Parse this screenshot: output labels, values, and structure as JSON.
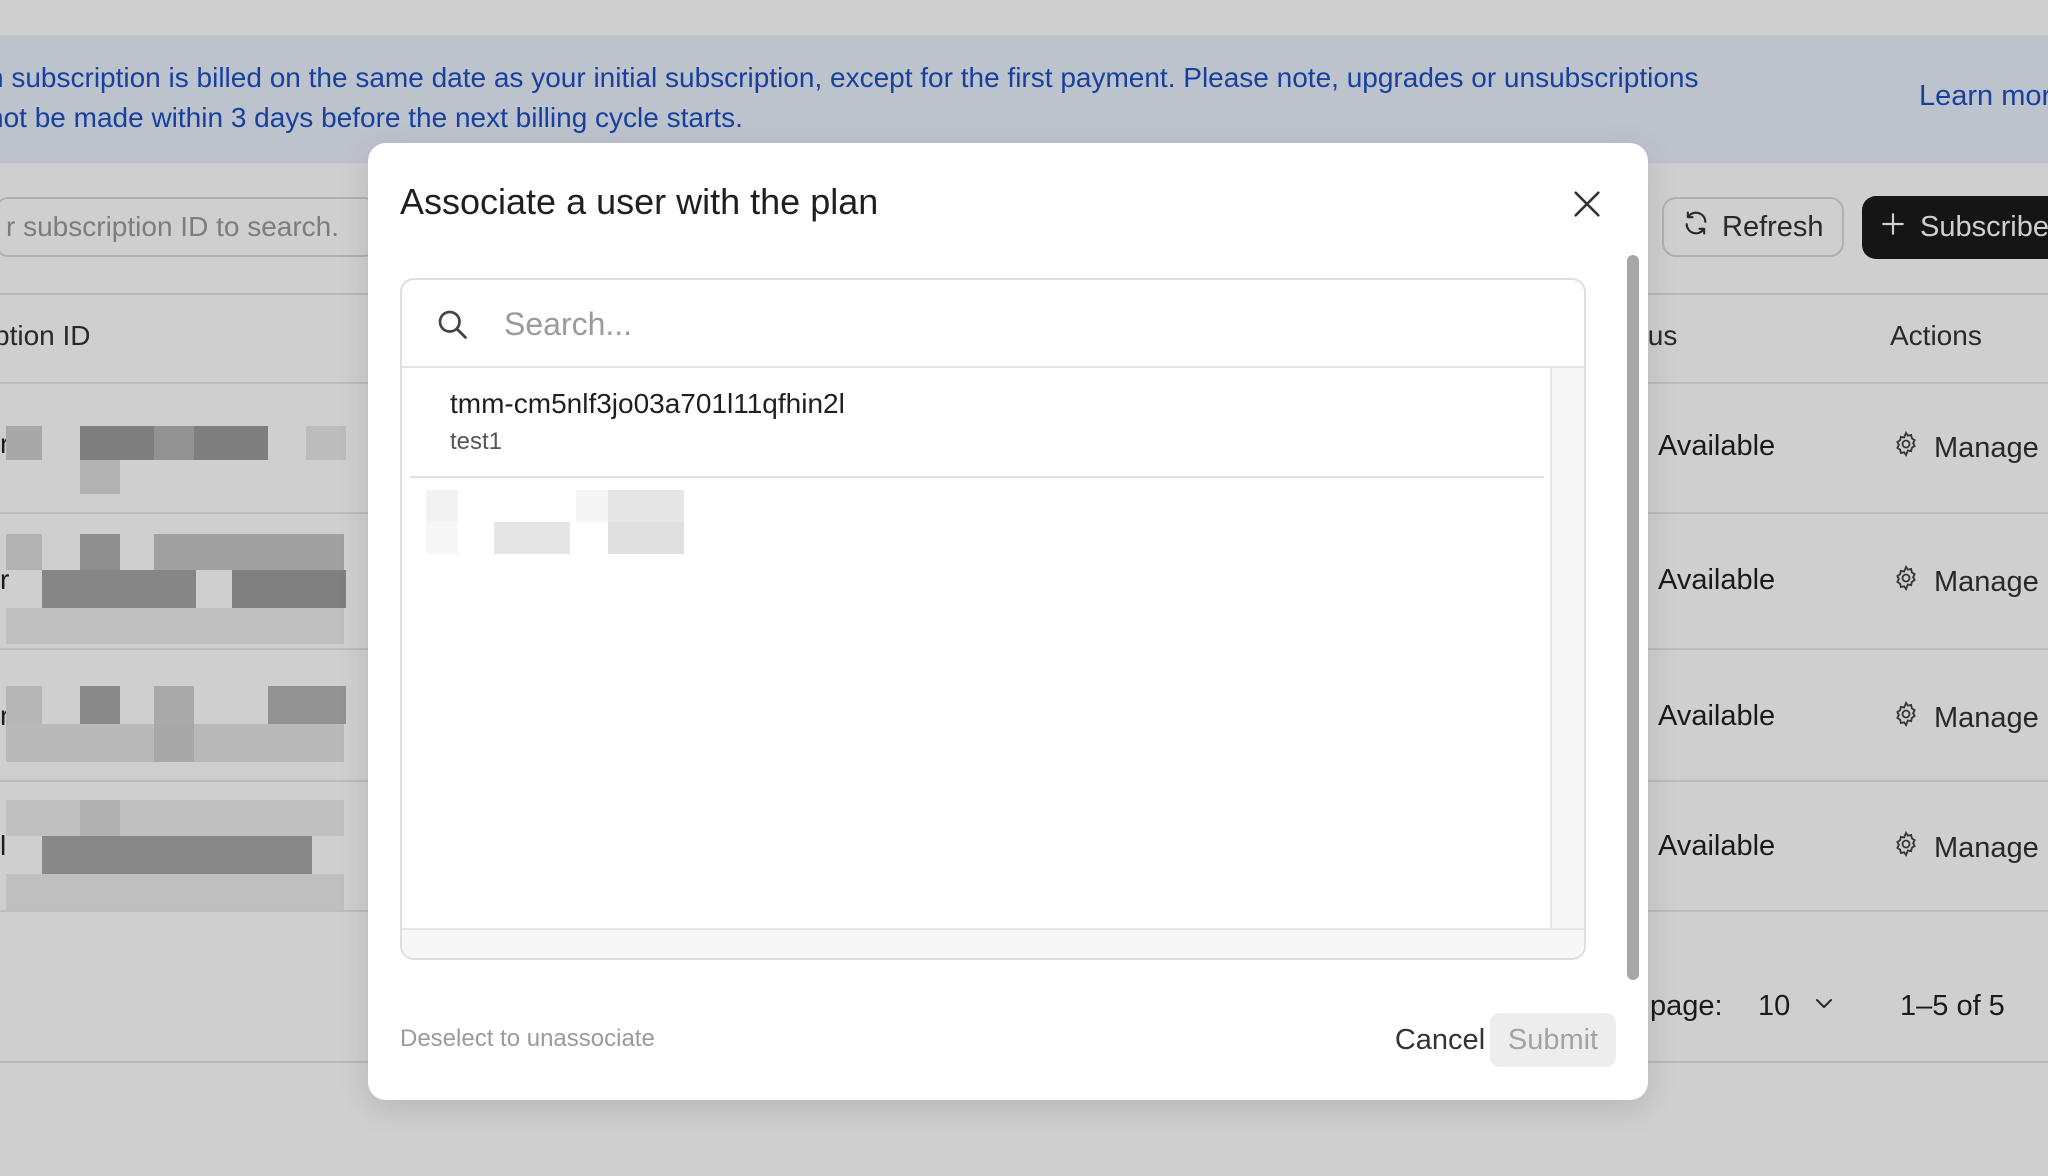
{
  "banner": {
    "text_line1": "h subscription is billed on the same date as your initial subscription, except for the first payment. Please note, upgrades or unsubscriptions",
    "text_line2": "not be made within 3 days before the next billing cycle starts.",
    "link": "Learn mor"
  },
  "toolbar": {
    "search_placeholder": "r subscription ID to search.",
    "refresh_label": "Refresh",
    "subscribe_label": "Subscribe"
  },
  "table": {
    "headers": {
      "subscription_id": "ption ID",
      "status": "tus",
      "actions": "Actions"
    },
    "rows": [
      {
        "id_visible": "r",
        "status": "Available",
        "action": "Manage"
      },
      {
        "id_visible": "r",
        "status": "Available",
        "action": "Manage"
      },
      {
        "id_visible": "r",
        "status": "Available",
        "action": "Manage"
      },
      {
        "id_visible": "l",
        "status": "Available",
        "action": "Manage"
      }
    ]
  },
  "pagination": {
    "rows_label": "page:",
    "rows_per_page": "10",
    "range": "1–5 of 5"
  },
  "modal": {
    "title": "Associate a user with the plan",
    "search_placeholder": "Search...",
    "items": [
      {
        "id": "tmm-cm5nlf3jo03a701l11qfhin2l",
        "name": "test1"
      }
    ],
    "footer_hint": "Deselect to unassociate",
    "cancel_label": "Cancel",
    "submit_label": "Submit"
  },
  "icons": {
    "close": "close-icon",
    "search": "search-icon",
    "refresh": "refresh-icon",
    "plus": "plus-icon",
    "gear": "gear-icon",
    "chevron": "chevron-down-icon"
  },
  "colors": {
    "banner_bg": "#e9f1fd",
    "banner_text": "#1d4fc4",
    "primary_button": "#1b1b1b",
    "overlay": "rgba(0,0,0,0.19)",
    "submit_disabled_bg": "#ededed"
  }
}
